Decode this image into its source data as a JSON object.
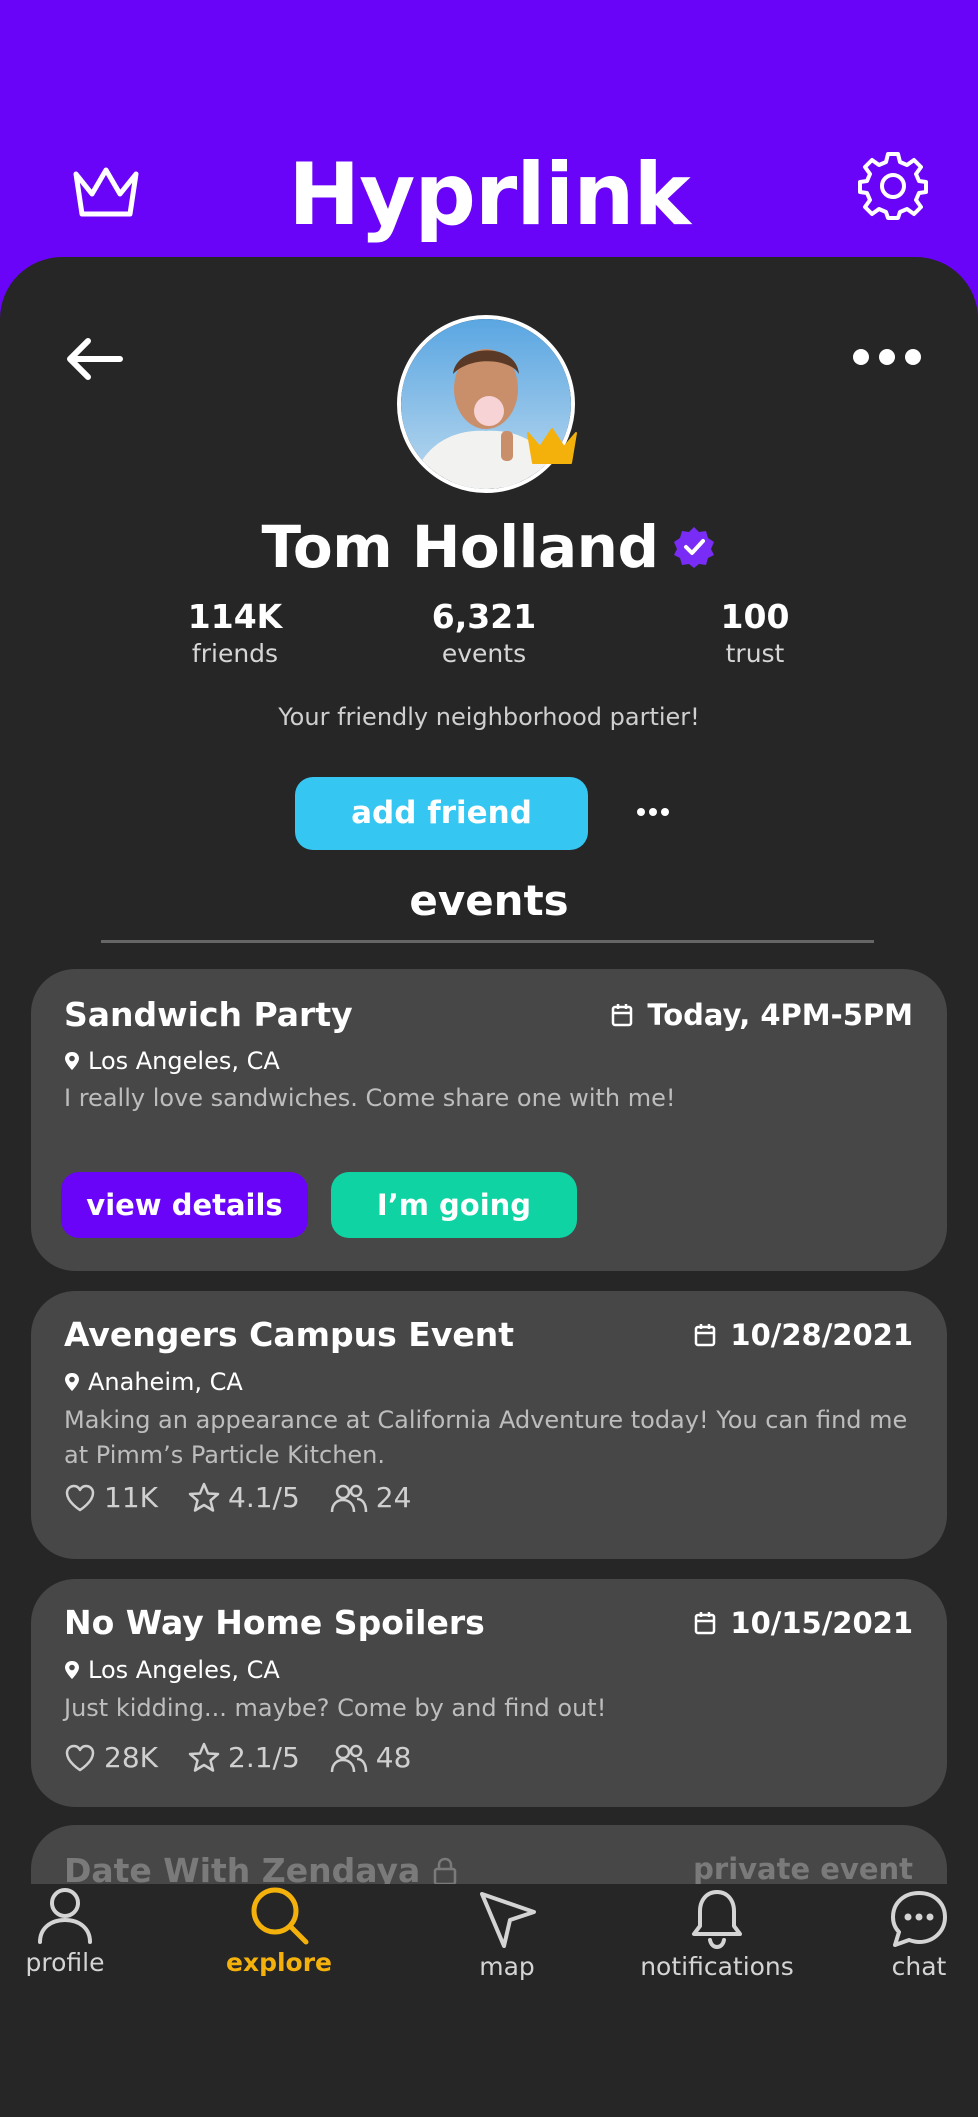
{
  "app": {
    "title": "Hyprlink"
  },
  "header": {
    "left_icon": "crown-icon",
    "right_icon": "gear-icon"
  },
  "profile": {
    "name": "Tom Holland",
    "verified_icon": "verified-badge-icon",
    "stats": [
      {
        "value": "114K",
        "label": "friends"
      },
      {
        "value": "6,321",
        "label": "events"
      },
      {
        "value": "100",
        "label": "trust"
      }
    ],
    "bio": "Your friendly neighborhood partier!",
    "add_friend_label": "add friend"
  },
  "events": {
    "heading": "events",
    "cards": [
      {
        "title": "Sandwich Party",
        "date": "Today, 4PM-5PM",
        "location": "Los Angeles, CA",
        "description": "I really love sandwiches. Come share one with me!",
        "buttons": {
          "details": "view details",
          "going": "I’m going"
        }
      },
      {
        "title": "Avengers Campus Event",
        "date": "10/28/2021",
        "location": "Anaheim, CA",
        "description": "Making an appearance at California Adventure today! You can find me at Pimm’s Particle Kitchen.",
        "likes": "11K",
        "rating": "4.1/5",
        "attendees": "24"
      },
      {
        "title": "No Way Home Spoilers",
        "date": "10/15/2021",
        "location": "Los Angeles, CA",
        "description": "Just kidding... maybe? Come by and find out!",
        "likes": "28K",
        "rating": "2.1/5",
        "attendees": "48"
      },
      {
        "title": "Date With Zendaya",
        "status": "private event"
      }
    ]
  },
  "nav": {
    "items": [
      {
        "label": "profile",
        "icon": "user-icon"
      },
      {
        "label": "explore",
        "icon": "search-icon",
        "active": true
      },
      {
        "label": "map",
        "icon": "navigation-arrow-icon"
      },
      {
        "label": "notifications",
        "icon": "bell-icon"
      },
      {
        "label": "chat",
        "icon": "chat-bubble-icon"
      }
    ]
  },
  "colors": {
    "brand_purple": "#6a04f9",
    "panel": "#262626",
    "card": "#474747",
    "add_friend": "#36c6f2",
    "going": "#0fd3a3",
    "accent_gold": "#f4b10c"
  }
}
